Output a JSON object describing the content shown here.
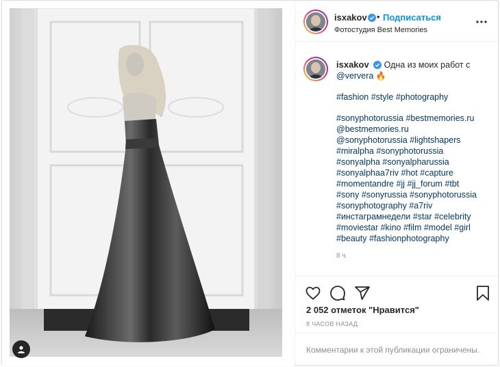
{
  "post": {
    "author": "isxakov",
    "follow_label": "Подписаться",
    "location": "Фотостудия Best Memories",
    "separator": "•"
  },
  "caption": {
    "username": "isxakov",
    "intro": "Одна из моих работ с",
    "mention": "@ververa",
    "emoji": "🔥",
    "hashtag_line_1": "#fashion #style #photography",
    "lines": [
      "#sonyphotorussia #bestmemories.ru",
      "@bestmemories.ru",
      "@sonyphotorussia #lightshapers",
      "#miralpha #sonyphotorussia",
      "#sonyalpha #sonyalpharussia",
      "#sonyalphaa7riv #hot #capture",
      "#momentandre #jj #jj_forum #tbt",
      "#sony #sonyrussia #sonyphotorussia",
      "#sonyphotography #a7riv",
      "#инстаграмнедели #star #celebrity",
      "#moviestar #kino #film #model #girl",
      "#beauty #fashionphotography"
    ],
    "time_ago": "8 ч."
  },
  "engagement": {
    "likes_text": "2 052 отметок \"Нравится\"",
    "posted_time": "8 ЧАСОВ НАЗАД",
    "comments_notice": "Комментарии к этой публикации ограничены."
  },
  "icons": {
    "like": "heart-icon",
    "comment": "comment-icon",
    "share": "share-icon",
    "save": "bookmark-icon",
    "more": "more-dots-icon",
    "tag": "user-tag-icon",
    "verified": "verified-badge-icon"
  },
  "colors": {
    "accent": "#0095f6",
    "link": "#00376b",
    "muted": "#8e8e8e",
    "verified": "#3897f0"
  }
}
